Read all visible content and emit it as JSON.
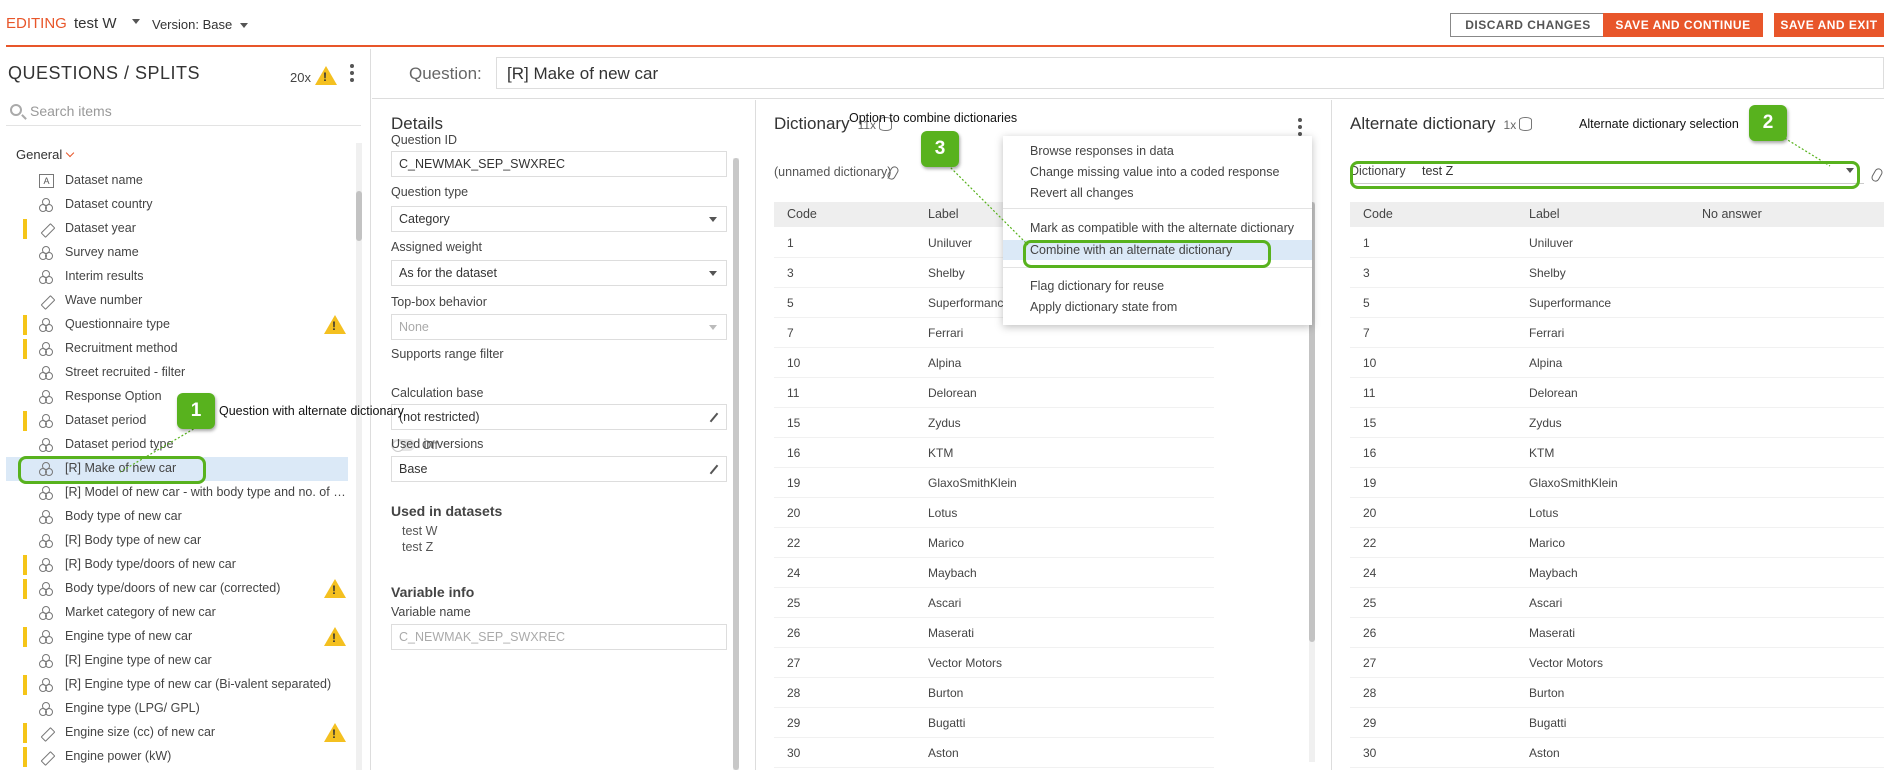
{
  "topbar": {
    "mode": "EDITING",
    "dataset": "test W",
    "version": "Version: Base",
    "discard": "DISCARD CHANGES",
    "save_continue": "SAVE AND CONTINUE",
    "save_exit": "SAVE AND EXIT"
  },
  "left": {
    "title": "QUESTIONS / SPLITS",
    "count": "20x",
    "search_placeholder": "Search items",
    "group": "General",
    "items": [
      {
        "label": "Dataset name",
        "icon": "text-icon",
        "flag": false,
        "warn": false
      },
      {
        "label": "Dataset country",
        "icon": "category-icon",
        "flag": false,
        "warn": false
      },
      {
        "label": "Dataset year",
        "icon": "numeric-icon",
        "flag": true,
        "warn": false
      },
      {
        "label": "Survey name",
        "icon": "category-icon",
        "flag": false,
        "warn": false
      },
      {
        "label": "Interim results",
        "icon": "category-icon",
        "flag": false,
        "warn": false
      },
      {
        "label": "Wave number",
        "icon": "numeric-icon",
        "flag": false,
        "warn": false
      },
      {
        "label": "Questionnaire type",
        "icon": "category-icon",
        "flag": true,
        "warn": true
      },
      {
        "label": "Recruitment method",
        "icon": "category-icon",
        "flag": true,
        "warn": false
      },
      {
        "label": "Street recruited - filter",
        "icon": "category-icon",
        "flag": false,
        "warn": false
      },
      {
        "label": "Response Option",
        "icon": "category-icon",
        "flag": false,
        "warn": false
      },
      {
        "label": "Dataset period",
        "icon": "category-icon",
        "flag": true,
        "warn": false
      },
      {
        "label": "Dataset period type",
        "icon": "category-icon",
        "flag": false,
        "warn": false
      },
      {
        "label": "[R] Make of new car",
        "icon": "category-icon",
        "flag": false,
        "warn": false,
        "selected": true
      },
      {
        "label": "[R] Model of new car - with body type and no. of doors",
        "icon": "category-icon",
        "flag": false,
        "warn": false
      },
      {
        "label": "Body type of new car",
        "icon": "category-icon",
        "flag": false,
        "warn": false
      },
      {
        "label": "[R] Body type of new car",
        "icon": "category-icon",
        "flag": false,
        "warn": false
      },
      {
        "label": "[R] Body type/doors of new car",
        "icon": "category-icon",
        "flag": true,
        "warn": false
      },
      {
        "label": "Body type/doors of new car (corrected)",
        "icon": "category-icon",
        "flag": true,
        "warn": true
      },
      {
        "label": "Market category of new car",
        "icon": "category-icon",
        "flag": false,
        "warn": false
      },
      {
        "label": "Engine type of new car",
        "icon": "category-icon",
        "flag": true,
        "warn": true
      },
      {
        "label": "[R] Engine type of new car",
        "icon": "category-icon",
        "flag": false,
        "warn": false
      },
      {
        "label": "[R] Engine type of new car (Bi-valent separated)",
        "icon": "category-icon",
        "flag": true,
        "warn": false
      },
      {
        "label": "Engine type (LPG/ GPL)",
        "icon": "category-icon",
        "flag": false,
        "warn": false
      },
      {
        "label": "Engine size (cc) of new car",
        "icon": "numeric-icon",
        "flag": true,
        "warn": true
      },
      {
        "label": "Engine power (kW)",
        "icon": "numeric-icon",
        "flag": true,
        "warn": false
      }
    ]
  },
  "question": {
    "label": "Question:",
    "value": "[R] Make of new car"
  },
  "details": {
    "title": "Details",
    "question_id_label": "Question ID",
    "question_id": "C_NEWMAK_SEP_SWXREC",
    "question_type_label": "Question type",
    "question_type": "Category",
    "weight_label": "Assigned weight",
    "weight": "As for the dataset",
    "topbox_label": "Top-box behavior",
    "topbox": "None",
    "range_label": "Supports range filter",
    "range_state": "Off",
    "calc_label": "Calculation base",
    "calc": "(not restricted)",
    "versions_label": "Used in versions",
    "versions": "Base",
    "datasets_label": "Used in datasets",
    "datasets": [
      "test W",
      "test Z"
    ],
    "varinfo_label": "Variable info",
    "varname_label": "Variable name",
    "varname": "C_NEWMAK_SEP_SWXREC"
  },
  "dictionary": {
    "title": "Dictionary",
    "count": "11x",
    "unnamed": "(unnamed dictionary)",
    "col_code": "Code",
    "col_label": "Label",
    "rows": [
      {
        "code": "1",
        "label": "Uniluver"
      },
      {
        "code": "3",
        "label": "Shelby"
      },
      {
        "code": "5",
        "label": "Superformance"
      },
      {
        "code": "7",
        "label": "Ferrari"
      },
      {
        "code": "10",
        "label": "Alpina"
      },
      {
        "code": "11",
        "label": "Delorean"
      },
      {
        "code": "15",
        "label": "Zydus"
      },
      {
        "code": "16",
        "label": "KTM"
      },
      {
        "code": "19",
        "label": "GlaxoSmithKlein"
      },
      {
        "code": "20",
        "label": "Lotus"
      },
      {
        "code": "22",
        "label": "Marico"
      },
      {
        "code": "24",
        "label": "Maybach"
      },
      {
        "code": "25",
        "label": "Ascari"
      },
      {
        "code": "26",
        "label": "Maserati"
      },
      {
        "code": "27",
        "label": "Vector Motors"
      },
      {
        "code": "28",
        "label": "Burton"
      },
      {
        "code": "29",
        "label": "Bugatti"
      },
      {
        "code": "30",
        "label": "Aston"
      }
    ]
  },
  "menu": {
    "items": [
      "Browse responses in data",
      "Change missing value into a coded response",
      "Revert all changes",
      "Mark as compatible with the alternate dictionary",
      "Combine with an alternate dictionary",
      "Flag dictionary for reuse",
      "Apply dictionary state from"
    ]
  },
  "alternate": {
    "title": "Alternate dictionary",
    "count": "1x",
    "dropdown_label": "Dictionary",
    "dropdown_value": "test Z",
    "col_code": "Code",
    "col_label": "Label",
    "col_noanswer": "No answer",
    "rows": [
      {
        "code": "1",
        "label": "Uniluver"
      },
      {
        "code": "3",
        "label": "Shelby"
      },
      {
        "code": "5",
        "label": "Superformance"
      },
      {
        "code": "7",
        "label": "Ferrari"
      },
      {
        "code": "10",
        "label": "Alpina"
      },
      {
        "code": "11",
        "label": "Delorean"
      },
      {
        "code": "15",
        "label": "Zydus"
      },
      {
        "code": "16",
        "label": "KTM"
      },
      {
        "code": "19",
        "label": "GlaxoSmithKlein"
      },
      {
        "code": "20",
        "label": "Lotus"
      },
      {
        "code": "22",
        "label": "Marico"
      },
      {
        "code": "24",
        "label": "Maybach"
      },
      {
        "code": "25",
        "label": "Ascari"
      },
      {
        "code": "26",
        "label": "Maserati"
      },
      {
        "code": "27",
        "label": "Vector Motors"
      },
      {
        "code": "28",
        "label": "Burton"
      },
      {
        "code": "29",
        "label": "Bugatti"
      },
      {
        "code": "30",
        "label": "Aston"
      }
    ]
  },
  "annotations": {
    "one": {
      "num": "1",
      "text": "Question with alternate dictionary"
    },
    "two": {
      "num": "2",
      "text": "Alternate dictionary selection"
    },
    "three": {
      "num": "3",
      "text": "Option to combine dictionaries"
    }
  },
  "colors": {
    "accent": "#e8562a",
    "highlight": "#58b21e",
    "selection": "#dbe9f7",
    "flag": "#f5c518"
  }
}
